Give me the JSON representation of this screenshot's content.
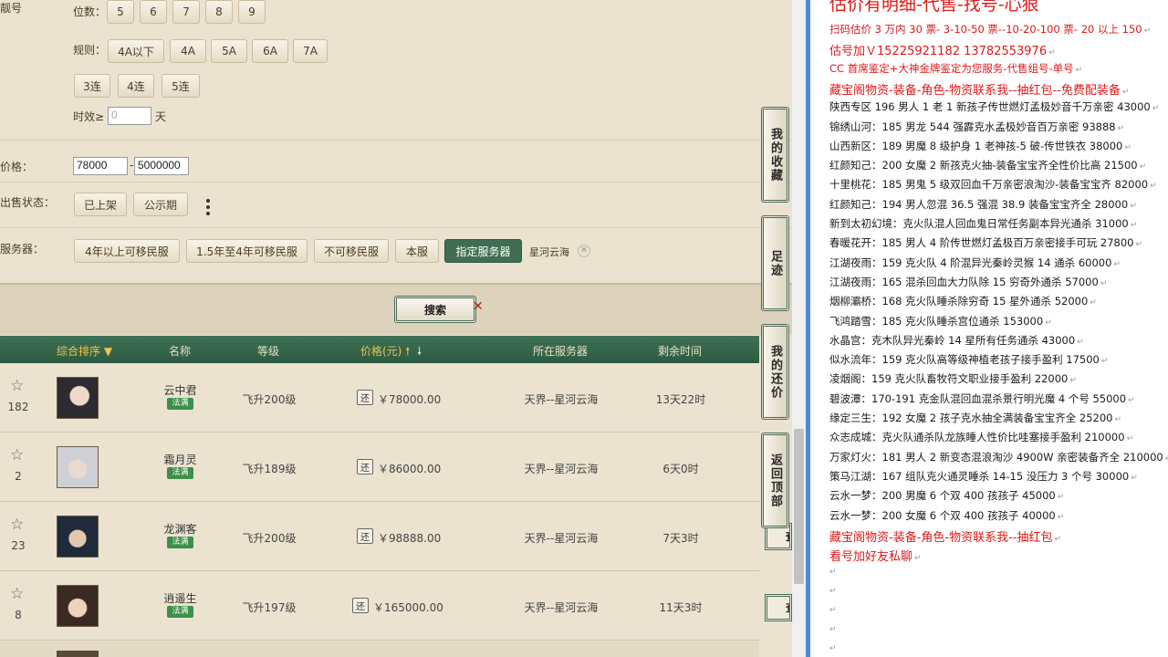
{
  "filters": {
    "account_label": "靓号",
    "digits_label": "位数：",
    "digits": [
      "5",
      "6",
      "7",
      "8",
      "9"
    ],
    "rules_label": "规则：",
    "rules": [
      "4A以下",
      "4A",
      "5A",
      "6A",
      "7A"
    ],
    "consecutive": [
      "3连",
      "4连",
      "5连"
    ],
    "validity_label": "时效≥",
    "validity_placeholder": "0",
    "validity_unit": "天",
    "price_label": "价格：",
    "price_min": "78000",
    "price_sep": "-",
    "price_max": "5000000",
    "sale_status_label": "出售状态：",
    "sale_status": [
      "已上架",
      "公示期"
    ],
    "more_icon": "vertical-dots-icon",
    "server_label": "服务器：",
    "servers": [
      "4年以上可移民服",
      "1.5年至4年可移民服",
      "不可移民服",
      "本服",
      "指定服务器"
    ],
    "selected_server": "星河云海"
  },
  "search": {
    "label": "搜索"
  },
  "table": {
    "headers": {
      "sort": "综合排序",
      "name": "名称",
      "level": "等级",
      "price": "价格(元)",
      "server": "所在服务器",
      "time_left": "剩余时间"
    },
    "rows": [
      {
        "favorites": "182",
        "name": "云中君",
        "badge": "法满",
        "level": "飞升200级",
        "price": "￥78000.00",
        "server": "天界--星河云海",
        "time_left": "13天22时"
      },
      {
        "favorites": "2",
        "name": "霜月灵",
        "badge": "法满",
        "level": "飞升189级",
        "price": "￥86000.00",
        "server": "天界--星河云海",
        "time_left": "6天0时"
      },
      {
        "favorites": "23",
        "name": "龙渊客",
        "badge": "法满",
        "level": "飞升200级",
        "price": "￥98888.00",
        "server": "天界--星河云海",
        "time_left": "7天3时"
      },
      {
        "favorites": "8",
        "name": "逍遥生",
        "badge": "法满",
        "level": "飞升197级",
        "price": "￥165000.00",
        "server": "天界--星河云海",
        "time_left": "11天3时"
      }
    ],
    "bargain_label": "还",
    "view_label": "查"
  },
  "side_buttons": [
    "我的收藏",
    "足迹",
    "我的还价",
    "返回顶部"
  ],
  "notes": {
    "headline": "估价有明细-代售-找号-心狠",
    "lines": [
      {
        "text": "扫码估价 3 万内 30 票- 3-10-50 票--10-20-100 票- 20 以上 150",
        "red": true
      },
      {
        "text": "估号加Ｖ15225921182   13782553976",
        "red": true,
        "big": true
      },
      {
        "text": "CC 首席鉴定+大神金牌鉴定为您服务-代售组号-单号",
        "red": true
      },
      {
        "text": "藏宝阁物资-装备-角色-物资联系我--抽红包--免费配装备",
        "red": true,
        "big": true
      },
      {
        "text": "陕西专区 196 男人 1 老 1 新孩子传世燃灯孟极妙音千万亲密 43000"
      },
      {
        "text": "锦绣山河：185 男龙 544 强霹克水孟极妙音百万亲密 93888"
      },
      {
        "text": "山西新区：189 男魔 8 级护身 1 老神孩-5 破-传世铁衣 38000"
      },
      {
        "text": "红颜知己：200 女魔 2 新孩克火抽-装备宝宝齐全性价比高 21500"
      },
      {
        "text": "十里桃花：185 男鬼 5 级双回血千万亲密浪淘沙-装备宝宝齐 82000"
      },
      {
        "text": "红颜知己：194 男人忽混 36.5 强混 38.9 装备宝宝齐全 28000"
      },
      {
        "text": "新到太初幻境：克火队混人回血鬼日常任务副本异光通杀 31000"
      },
      {
        "text": "春暖花开：185 男人 4 阶传世燃灯孟极百万亲密接手可玩 27800"
      },
      {
        "text": "江湖夜雨：159 克火队 4 阶混异光秦岭灵猴 14 通杀 60000"
      },
      {
        "text": "江湖夜雨：165 混杀回血大力队除 15 穷奇外通杀 57000"
      },
      {
        "text": "烟柳灞桥：168 克火队睡杀除穷奇 15 星外通杀 52000"
      },
      {
        "text": "飞鸿踏雪：185 克火队睡杀宫位通杀 153000"
      },
      {
        "text": "水晶宫：克木队异光秦岭 14 星所有任务通杀 43000"
      },
      {
        "text": "似水流年：159 克火队高等级神植老孩子接手盈利 17500"
      },
      {
        "text": "凌烟阁：159 克火队畜牧符文职业接手盈利 22000"
      },
      {
        "text": "碧波潭：170-191 克金队混回血混杀景行明光魔 4 个号 55000"
      },
      {
        "text": "缘定三生：192 女魔 2 孩子克水抽全满装备宝宝齐全 25200"
      },
      {
        "text": "众志成城：克火队通杀队龙族睡人性价比哇塞接手盈利 210000"
      },
      {
        "text": "万家灯火：181 男人 2 新变态混浪淘沙 4900W 亲密装备齐全 210000"
      },
      {
        "text": "策马江湖：167 组队克火通灵睡杀 14-15 没压力 3 个号 30000"
      },
      {
        "text": "云水一梦：200 男魔 6 个双 400 孩孩子 45000"
      },
      {
        "text": "云水一梦：200 女魔 6 个双 400 孩孩子 40000"
      },
      {
        "text": "藏宝阁物资-装备-角色-物资联系我--抽红包",
        "red": true,
        "big": true
      },
      {
        "text": "看号加好友私聊",
        "red": true,
        "big": true
      }
    ],
    "paragraph_mark": "↵"
  },
  "colors": {
    "accent_green": "#3f6e52",
    "note_red": "#e01818",
    "divider_blue": "#4d8bd0"
  }
}
